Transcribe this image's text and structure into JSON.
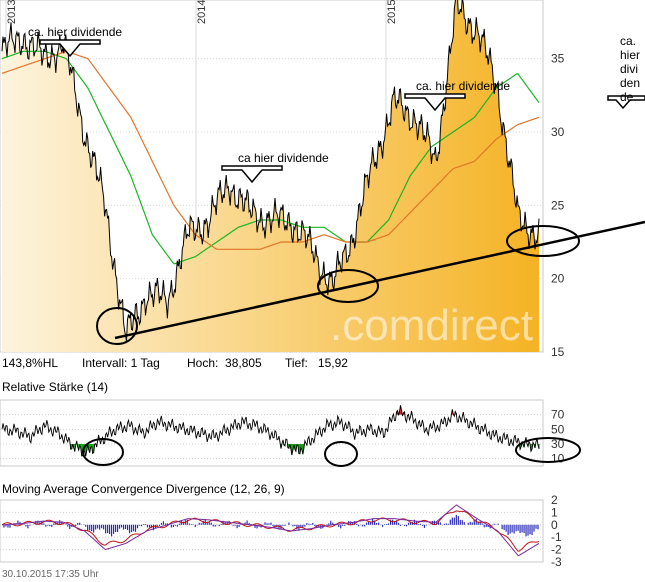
{
  "chart_data": [
    {
      "type": "area",
      "ylim": [
        15,
        39
      ],
      "y_ticks": [
        15,
        20,
        25,
        30,
        35
      ],
      "year_labels": [
        "2013",
        "2014",
        "2015"
      ],
      "series": [
        {
          "x": [
            "2013-01",
            "2013-03",
            "2013-05",
            "2013-06",
            "2013-08",
            "2013-09",
            "2013-10",
            "2013-11",
            "2014-01",
            "2014-03",
            "2014-04",
            "2014-05",
            "2014-06",
            "2014-08",
            "2014-09",
            "2014-10",
            "2014-11",
            "2015-01",
            "2015-02",
            "2015-03",
            "2015-04",
            "2015-05",
            "2015-06",
            "2015-07",
            "2015-08",
            "2015-09",
            "2015-10"
          ],
          "values": [
            35.5,
            36.5,
            35,
            36,
            30,
            25,
            16,
            19,
            18.5,
            23,
            24,
            26.5,
            24.5,
            24,
            24,
            22,
            19.5,
            23,
            28,
            32,
            31,
            28,
            38.5,
            37,
            33,
            24,
            23
          ]
        },
        {
          "values": [
            35,
            35.5,
            35.5,
            35,
            33,
            30,
            27,
            23,
            21,
            21.5,
            22.5,
            23.5,
            24,
            24,
            23.5,
            23.5,
            22.5,
            22.5,
            24,
            27,
            29,
            30,
            31,
            33,
            34,
            32
          ]
        },
        {
          "values": [
            34,
            34.5,
            35,
            35.5,
            35,
            33,
            31,
            28,
            25,
            23,
            22,
            22,
            22,
            22.5,
            22.5,
            23,
            22.5,
            22.5,
            23,
            24.5,
            26,
            27.5,
            28,
            29.5,
            30.5,
            31
          ]
        }
      ],
      "annotations": [
        "ca. hier dividende",
        "ca hier dividende",
        "ca. hier dividende"
      ],
      "stats": {
        "hl": "143,8%HL",
        "interval": "Intervall: 1 Tag",
        "high": "Hoch:  38,805",
        "low": "Tief:   15,92"
      },
      "watermark": ".comdirect",
      "colors": {
        "area_top": "#f5b324",
        "area_bottom": "#fdf3dd",
        "ma_short": "#1bb522",
        "ma_long": "#e0762a",
        "price": "#000000"
      }
    },
    {
      "type": "line",
      "title": "Relative Stärke (14)",
      "ylim": [
        0,
        90
      ],
      "y_ticks": [
        10,
        30,
        50,
        70
      ],
      "values": [
        50,
        48,
        40,
        55,
        45,
        28,
        18,
        35,
        50,
        55,
        45,
        60,
        55,
        50,
        45,
        40,
        50,
        60,
        55,
        45,
        30,
        20,
        38,
        55,
        60,
        45,
        50,
        45,
        75,
        65,
        50,
        55,
        70,
        60,
        50,
        40,
        35,
        30,
        28
      ]
    },
    {
      "type": "line",
      "title": "Moving Average Convergence Divergence (12, 26, 9)",
      "ylim": [
        -3,
        2
      ],
      "y_ticks": [
        2,
        1,
        0,
        -1,
        -2,
        -3
      ],
      "values": [
        0,
        0.1,
        0.3,
        0.2,
        -0.5,
        -2,
        -1.5,
        -0.5,
        0,
        0.5,
        0.4,
        0.2,
        0,
        -0.2,
        -0.5,
        -0.3,
        0,
        0.2,
        0.5,
        0.5,
        0.3,
        0.2,
        1.6,
        0.5,
        -0.5,
        -2.5,
        -1.5
      ]
    }
  ],
  "side_note": "ca. hier dividende",
  "footer": "30.10.2015 17:35 Uhr"
}
